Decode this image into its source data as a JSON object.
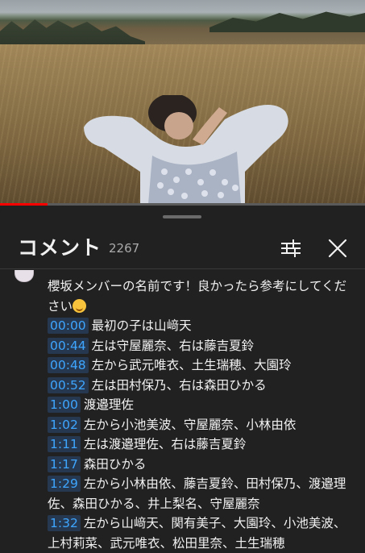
{
  "progress": {
    "played_fraction": 0.13
  },
  "comments_panel": {
    "title": "コメント",
    "count": "2267",
    "filter_icon": "tune-icon",
    "close_icon": "close-icon"
  },
  "comment": {
    "intro": "櫻坂メンバーの名前です！良かったら参考にしてください",
    "emoji": "smiling-face-emoji",
    "timestamps": [
      {
        "time": "00:00",
        "text": "最初の子は山﨑天"
      },
      {
        "time": "00:44",
        "text": "左は守屋麗奈、右は藤吉夏鈴"
      },
      {
        "time": "00:48",
        "text": "左から武元唯衣、土生瑞穂、大園玲"
      },
      {
        "time": "00:52",
        "text": "左は田村保乃、右は森田ひかる"
      },
      {
        "time": "1:00",
        "text": "渡邉理佐"
      },
      {
        "time": "1:02",
        "text": "左から小池美波、守屋麗奈、小林由依"
      },
      {
        "time": "1:11",
        "text": "左は渡邉理佐、右は藤吉夏鈴"
      },
      {
        "time": "1:17",
        "text": "森田ひかる"
      },
      {
        "time": "1:29",
        "text": "左から小林由依、藤吉夏鈴、田村保乃、渡邉理佐、森田ひかる、井上梨名、守屋麗奈"
      },
      {
        "time": "1:32",
        "text": "左から山﨑天、関有美子、大園玲、小池美波、上村莉菜、武元唯衣、松田里奈、土生瑞穂"
      }
    ]
  }
}
